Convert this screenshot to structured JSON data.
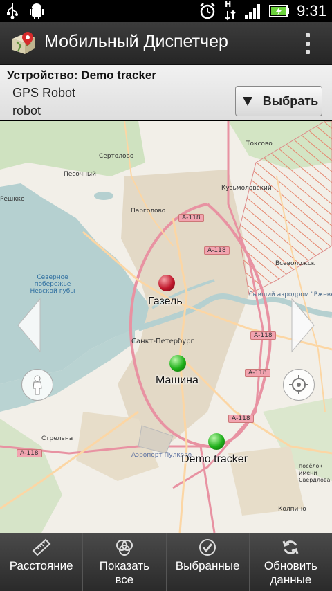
{
  "status_bar": {
    "time": "9:31",
    "network": "H"
  },
  "app": {
    "title": "Мобильный Диспетчер"
  },
  "device": {
    "prefix": "Устройство:",
    "name": "Demo tracker",
    "line2": "GPS Robot",
    "line3": "robot",
    "select_label": "Выбрать"
  },
  "map": {
    "labels": {
      "toksovo": "Токсово",
      "sertolovo": "Сертолово",
      "pesochny": "Песочный",
      "kuzmolovsky": "Кузьмоловский",
      "pargolovo": "Парголово",
      "a118_1": "А-118",
      "a118_2": "А-118",
      "a118_3": "А-118",
      "a118_4": "А-118",
      "a118_5": "А-118",
      "a118_6": "А-118",
      "vsevolozhsk": "Всеволожск",
      "spb": "Санкт-Петербург",
      "strelna": "Стрельна",
      "pulkovo": "Аэропорт Пулково",
      "kolpino": "Колпино",
      "sverdlova": "посёлок имени Свердлова",
      "rzhevka": "бывший аэродром \"Ржевка\"",
      "nevskaya": "Северное побережье Невской губы",
      "repino": "Решкко"
    },
    "markers": [
      {
        "label": "Газель",
        "color": "red"
      },
      {
        "label": "Машина",
        "color": "green"
      },
      {
        "label": "Demo tracker",
        "color": "green"
      }
    ]
  },
  "bottom_bar": {
    "items": [
      {
        "label": "Расстояние",
        "icon": "ruler-icon"
      },
      {
        "label": "Показать все",
        "icon": "circles-icon"
      },
      {
        "label": "Выбранные",
        "icon": "checkmark-icon"
      },
      {
        "label": "Обновить данные",
        "icon": "refresh-icon"
      }
    ]
  }
}
